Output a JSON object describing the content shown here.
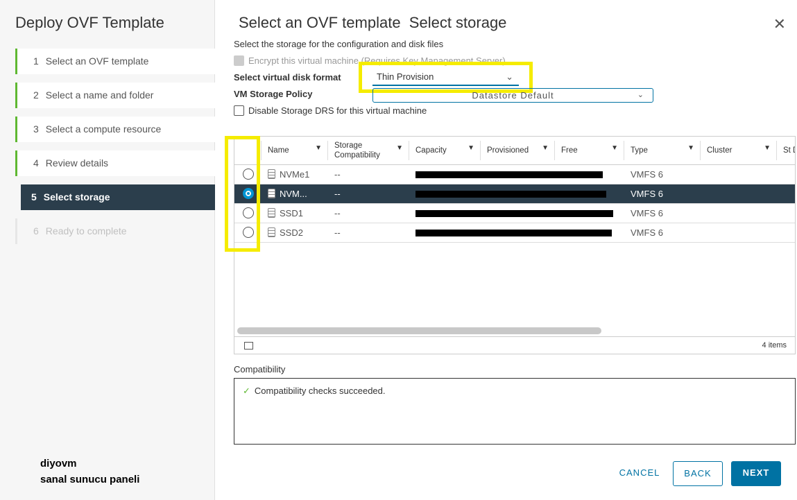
{
  "sidebar": {
    "title": "Deploy OVF Template",
    "steps": [
      {
        "n": "1",
        "label": "Select an OVF template"
      },
      {
        "n": "2",
        "label": "Select a name and folder"
      },
      {
        "n": "3",
        "label": "Select a compute resource"
      },
      {
        "n": "4",
        "label": "Review details"
      },
      {
        "n": "5",
        "label": "Select storage"
      },
      {
        "n": "6",
        "label": "Ready to complete"
      }
    ],
    "brand_line1": "diyovm",
    "brand_line2": "sanal sunucu paneli"
  },
  "main": {
    "title": "Select an OVF template  Select storage",
    "subtitle": "Select the storage for the configuration and disk files",
    "encrypt_label": "Encrypt this virtual machine (Requires Key Management Server)",
    "disk_format_label": "Select virtual disk format",
    "disk_format_value": "Thin Provision",
    "policy_label": "VM Storage Policy",
    "policy_value": "Datastore Default",
    "drs_label": "Disable Storage DRS for this virtual machine",
    "columns": [
      "Name",
      "Storage Compatibility",
      "Capacity",
      "Provisioned",
      "Free",
      "Type",
      "Cluster",
      "St D"
    ],
    "rows": [
      {
        "name": "NVMe1",
        "compat": "--",
        "type": "VMFS 6",
        "selected": false
      },
      {
        "name": "NVM...",
        "compat": "--",
        "type": "VMFS 6",
        "selected": true
      },
      {
        "name": "SSD1",
        "compat": "--",
        "type": "VMFS 6",
        "selected": false
      },
      {
        "name": "SSD2",
        "compat": "--",
        "type": "VMFS 6",
        "selected": false
      }
    ],
    "item_count": "4 items",
    "compat_label": "Compatibility",
    "compat_message": "Compatibility checks succeeded.",
    "cancel": "CANCEL",
    "back": "BACK",
    "next": "NEXT"
  },
  "colors": {
    "accent": "#0072a3",
    "selected_row": "#2b3e4c",
    "success": "#5fb832",
    "highlight": "#f5ec00"
  }
}
